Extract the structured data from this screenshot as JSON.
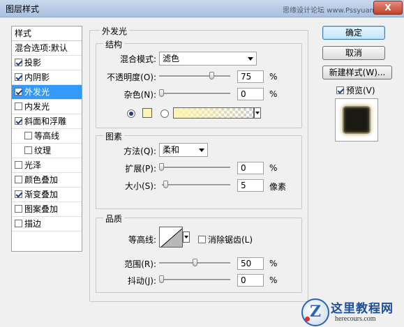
{
  "window": {
    "title": "图层样式",
    "watermark": "思缘设计论坛 www.Pssyuan.com",
    "close_glyph": "X"
  },
  "style_list": {
    "header": "样式",
    "blend_default": "混合选项:默认",
    "items": [
      {
        "label": "投影",
        "checked": true
      },
      {
        "label": "内阴影",
        "checked": true
      },
      {
        "label": "外发光",
        "checked": true,
        "selected": true
      },
      {
        "label": "内发光",
        "checked": false
      },
      {
        "label": "斜面和浮雕",
        "checked": true
      },
      {
        "label": "等高线",
        "checked": false,
        "sub": true
      },
      {
        "label": "纹理",
        "checked": false,
        "sub": true
      },
      {
        "label": "光泽",
        "checked": false
      },
      {
        "label": "颜色叠加",
        "checked": false
      },
      {
        "label": "渐变叠加",
        "checked": true
      },
      {
        "label": "图案叠加",
        "checked": false
      },
      {
        "label": "描边",
        "checked": false
      }
    ]
  },
  "outer_glow": {
    "title": "外发光",
    "structure": {
      "title": "结构",
      "blend_mode_label": "混合模式:",
      "blend_mode_value": "滤色",
      "opacity_label": "不透明度(O):",
      "opacity_value": "75",
      "opacity_unit": "%",
      "opacity_level": 0.75,
      "noise_label": "杂色(N):",
      "noise_value": "0",
      "noise_unit": "%",
      "noise_level": 0,
      "glow_color": "#fcf4b0",
      "solid_selected": true
    },
    "elements": {
      "title": "图素",
      "method_label": "方法(Q):",
      "method_value": "柔和",
      "spread_label": "扩展(P):",
      "spread_value": "0",
      "spread_unit": "%",
      "spread_level": 0,
      "size_label": "大小(S):",
      "size_value": "5",
      "size_unit": "像素",
      "size_level": 0.02
    },
    "quality": {
      "title": "品质",
      "contour_label": "等高线:",
      "antialias_label": "消除锯齿(L)",
      "antialias_checked": false,
      "range_label": "范围(R):",
      "range_value": "50",
      "range_unit": "%",
      "range_level": 0.5,
      "jitter_label": "抖动(J):",
      "jitter_value": "0",
      "jitter_unit": "%",
      "jitter_level": 0
    }
  },
  "buttons": {
    "ok": "确定",
    "cancel": "取消",
    "new_style": "新建样式(W)...",
    "preview_label": "预览(V)",
    "preview_checked": true
  },
  "logo": {
    "name": "这里教程网",
    "url": "herecours.com",
    "icon_letter": "Z"
  }
}
